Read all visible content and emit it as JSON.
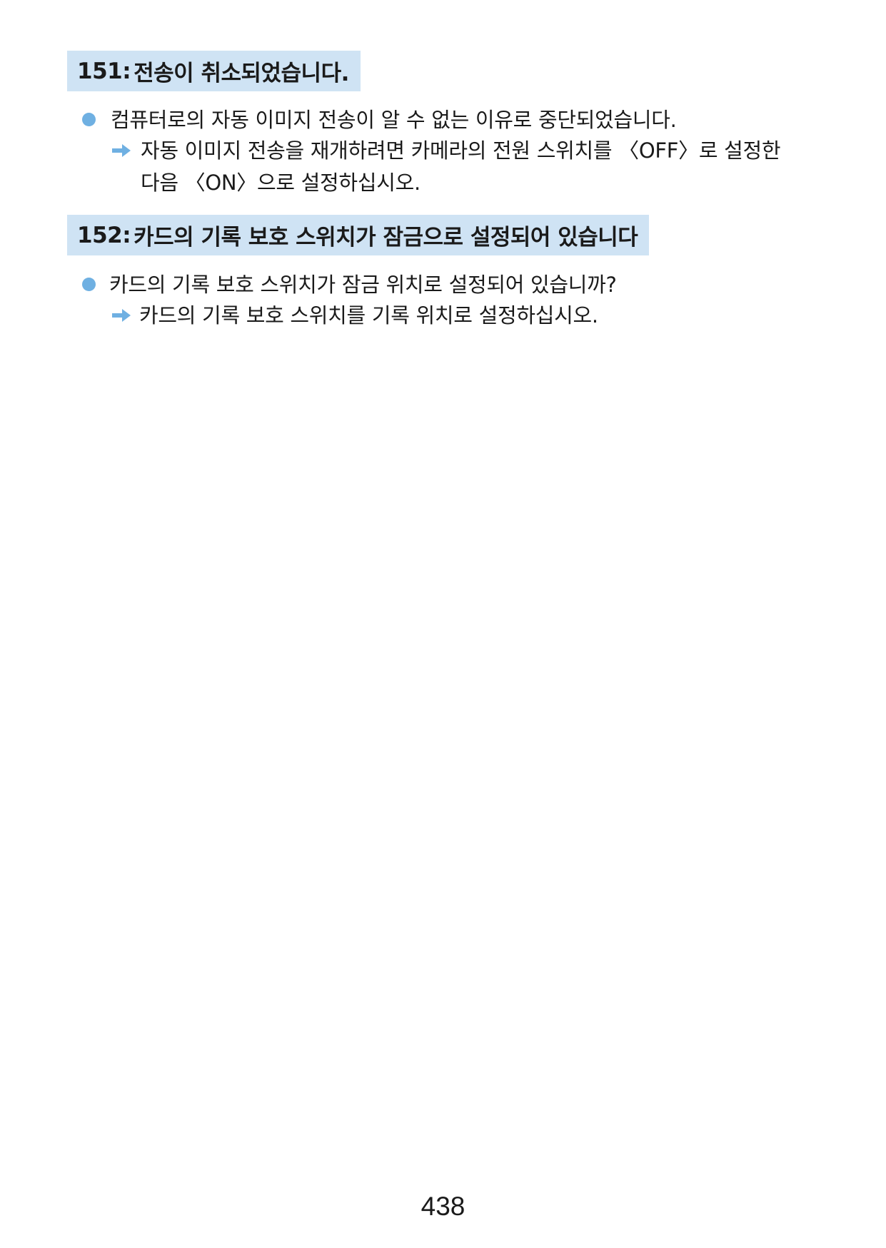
{
  "sections": [
    {
      "code": "151:",
      "title": "전송이 취소되었습니다.",
      "cause": "컴퓨터로의 자동 이미지 전송이 알 수 없는 이유로 중단되었습니다.",
      "remedy_lines": [
        "자동 이미지 전송을 재개하려면 카메라의 전원 스위치를 〈OFF〉로 설정한",
        "다음 〈ON〉으로 설정하십시오."
      ]
    },
    {
      "code": "152:",
      "title": "카드의 기록 보호 스위치가 잠금으로 설정되어 있습니다",
      "cause": "카드의 기록 보호 스위치가 잠금 위치로 설정되어 있습니까?",
      "remedy_lines": [
        "카드의 기록 보호 스위치를 기록 위치로 설정하십시오."
      ]
    }
  ],
  "page_number": "438",
  "colors": {
    "heading_bg": "#cfe3f4",
    "bullet": "#6fb0e2",
    "arrow": "#6fb0e2"
  }
}
